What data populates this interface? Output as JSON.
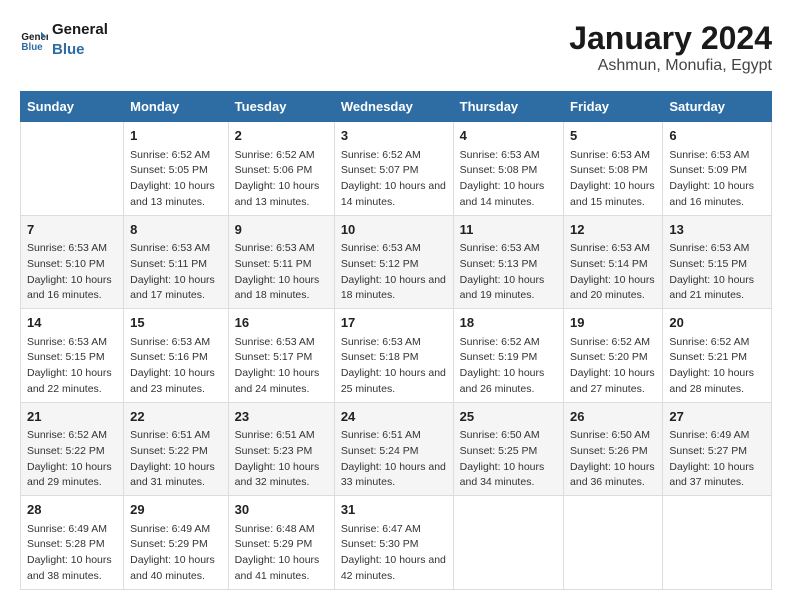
{
  "logo": {
    "line1": "General",
    "line2": "Blue"
  },
  "title": "January 2024",
  "location": "Ashmun, Monufia, Egypt",
  "days_of_week": [
    "Sunday",
    "Monday",
    "Tuesday",
    "Wednesday",
    "Thursday",
    "Friday",
    "Saturday"
  ],
  "weeks": [
    [
      {
        "day": "",
        "sunrise": "",
        "sunset": "",
        "daylight": ""
      },
      {
        "day": "1",
        "sunrise": "Sunrise: 6:52 AM",
        "sunset": "Sunset: 5:05 PM",
        "daylight": "Daylight: 10 hours and 13 minutes."
      },
      {
        "day": "2",
        "sunrise": "Sunrise: 6:52 AM",
        "sunset": "Sunset: 5:06 PM",
        "daylight": "Daylight: 10 hours and 13 minutes."
      },
      {
        "day": "3",
        "sunrise": "Sunrise: 6:52 AM",
        "sunset": "Sunset: 5:07 PM",
        "daylight": "Daylight: 10 hours and 14 minutes."
      },
      {
        "day": "4",
        "sunrise": "Sunrise: 6:53 AM",
        "sunset": "Sunset: 5:08 PM",
        "daylight": "Daylight: 10 hours and 14 minutes."
      },
      {
        "day": "5",
        "sunrise": "Sunrise: 6:53 AM",
        "sunset": "Sunset: 5:08 PM",
        "daylight": "Daylight: 10 hours and 15 minutes."
      },
      {
        "day": "6",
        "sunrise": "Sunrise: 6:53 AM",
        "sunset": "Sunset: 5:09 PM",
        "daylight": "Daylight: 10 hours and 16 minutes."
      }
    ],
    [
      {
        "day": "7",
        "sunrise": "Sunrise: 6:53 AM",
        "sunset": "Sunset: 5:10 PM",
        "daylight": "Daylight: 10 hours and 16 minutes."
      },
      {
        "day": "8",
        "sunrise": "Sunrise: 6:53 AM",
        "sunset": "Sunset: 5:11 PM",
        "daylight": "Daylight: 10 hours and 17 minutes."
      },
      {
        "day": "9",
        "sunrise": "Sunrise: 6:53 AM",
        "sunset": "Sunset: 5:11 PM",
        "daylight": "Daylight: 10 hours and 18 minutes."
      },
      {
        "day": "10",
        "sunrise": "Sunrise: 6:53 AM",
        "sunset": "Sunset: 5:12 PM",
        "daylight": "Daylight: 10 hours and 18 minutes."
      },
      {
        "day": "11",
        "sunrise": "Sunrise: 6:53 AM",
        "sunset": "Sunset: 5:13 PM",
        "daylight": "Daylight: 10 hours and 19 minutes."
      },
      {
        "day": "12",
        "sunrise": "Sunrise: 6:53 AM",
        "sunset": "Sunset: 5:14 PM",
        "daylight": "Daylight: 10 hours and 20 minutes."
      },
      {
        "day": "13",
        "sunrise": "Sunrise: 6:53 AM",
        "sunset": "Sunset: 5:15 PM",
        "daylight": "Daylight: 10 hours and 21 minutes."
      }
    ],
    [
      {
        "day": "14",
        "sunrise": "Sunrise: 6:53 AM",
        "sunset": "Sunset: 5:15 PM",
        "daylight": "Daylight: 10 hours and 22 minutes."
      },
      {
        "day": "15",
        "sunrise": "Sunrise: 6:53 AM",
        "sunset": "Sunset: 5:16 PM",
        "daylight": "Daylight: 10 hours and 23 minutes."
      },
      {
        "day": "16",
        "sunrise": "Sunrise: 6:53 AM",
        "sunset": "Sunset: 5:17 PM",
        "daylight": "Daylight: 10 hours and 24 minutes."
      },
      {
        "day": "17",
        "sunrise": "Sunrise: 6:53 AM",
        "sunset": "Sunset: 5:18 PM",
        "daylight": "Daylight: 10 hours and 25 minutes."
      },
      {
        "day": "18",
        "sunrise": "Sunrise: 6:52 AM",
        "sunset": "Sunset: 5:19 PM",
        "daylight": "Daylight: 10 hours and 26 minutes."
      },
      {
        "day": "19",
        "sunrise": "Sunrise: 6:52 AM",
        "sunset": "Sunset: 5:20 PM",
        "daylight": "Daylight: 10 hours and 27 minutes."
      },
      {
        "day": "20",
        "sunrise": "Sunrise: 6:52 AM",
        "sunset": "Sunset: 5:21 PM",
        "daylight": "Daylight: 10 hours and 28 minutes."
      }
    ],
    [
      {
        "day": "21",
        "sunrise": "Sunrise: 6:52 AM",
        "sunset": "Sunset: 5:22 PM",
        "daylight": "Daylight: 10 hours and 29 minutes."
      },
      {
        "day": "22",
        "sunrise": "Sunrise: 6:51 AM",
        "sunset": "Sunset: 5:22 PM",
        "daylight": "Daylight: 10 hours and 31 minutes."
      },
      {
        "day": "23",
        "sunrise": "Sunrise: 6:51 AM",
        "sunset": "Sunset: 5:23 PM",
        "daylight": "Daylight: 10 hours and 32 minutes."
      },
      {
        "day": "24",
        "sunrise": "Sunrise: 6:51 AM",
        "sunset": "Sunset: 5:24 PM",
        "daylight": "Daylight: 10 hours and 33 minutes."
      },
      {
        "day": "25",
        "sunrise": "Sunrise: 6:50 AM",
        "sunset": "Sunset: 5:25 PM",
        "daylight": "Daylight: 10 hours and 34 minutes."
      },
      {
        "day": "26",
        "sunrise": "Sunrise: 6:50 AM",
        "sunset": "Sunset: 5:26 PM",
        "daylight": "Daylight: 10 hours and 36 minutes."
      },
      {
        "day": "27",
        "sunrise": "Sunrise: 6:49 AM",
        "sunset": "Sunset: 5:27 PM",
        "daylight": "Daylight: 10 hours and 37 minutes."
      }
    ],
    [
      {
        "day": "28",
        "sunrise": "Sunrise: 6:49 AM",
        "sunset": "Sunset: 5:28 PM",
        "daylight": "Daylight: 10 hours and 38 minutes."
      },
      {
        "day": "29",
        "sunrise": "Sunrise: 6:49 AM",
        "sunset": "Sunset: 5:29 PM",
        "daylight": "Daylight: 10 hours and 40 minutes."
      },
      {
        "day": "30",
        "sunrise": "Sunrise: 6:48 AM",
        "sunset": "Sunset: 5:29 PM",
        "daylight": "Daylight: 10 hours and 41 minutes."
      },
      {
        "day": "31",
        "sunrise": "Sunrise: 6:47 AM",
        "sunset": "Sunset: 5:30 PM",
        "daylight": "Daylight: 10 hours and 42 minutes."
      },
      {
        "day": "",
        "sunrise": "",
        "sunset": "",
        "daylight": ""
      },
      {
        "day": "",
        "sunrise": "",
        "sunset": "",
        "daylight": ""
      },
      {
        "day": "",
        "sunrise": "",
        "sunset": "",
        "daylight": ""
      }
    ]
  ]
}
